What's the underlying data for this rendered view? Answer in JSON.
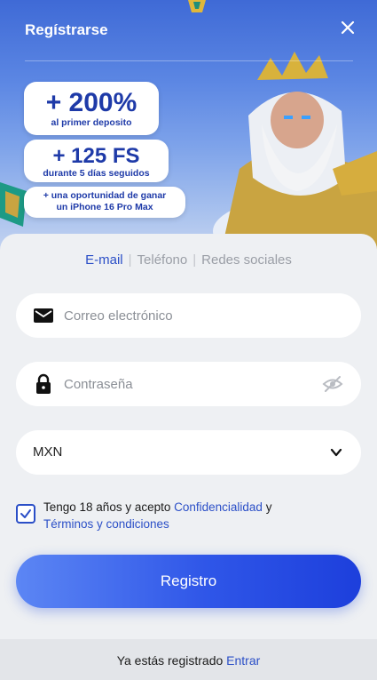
{
  "header": {
    "title": "Regístrarse",
    "close_icon": "close-icon"
  },
  "promos": [
    {
      "main": "+ 200%",
      "sub": "al primer deposito"
    },
    {
      "main": "+ 125 FS",
      "sub": "durante 5 días seguidos"
    },
    {
      "line1": "+ una oportunidad de ganar",
      "line2": "un iPhone 16 Pro Max"
    }
  ],
  "tabs": [
    {
      "label": "E-mail",
      "active": true
    },
    {
      "label": "Teléfono",
      "active": false
    },
    {
      "label": "Redes sociales",
      "active": false
    }
  ],
  "form": {
    "email_placeholder": "Correo electrónico",
    "password_placeholder": "Contraseña",
    "currency": "MXN",
    "terms_text": "Tengo 18 años y acepto",
    "privacy_link": "Confidencialidad",
    "and": "y",
    "terms_link": "Términos y condiciones",
    "submit": "Registro"
  },
  "footer": {
    "text": "Ya estás registrado",
    "login_link": "Entrar"
  },
  "colors": {
    "accent": "#2b4fc7",
    "button_start": "#5c86f4",
    "button_end": "#1d3fdc"
  }
}
